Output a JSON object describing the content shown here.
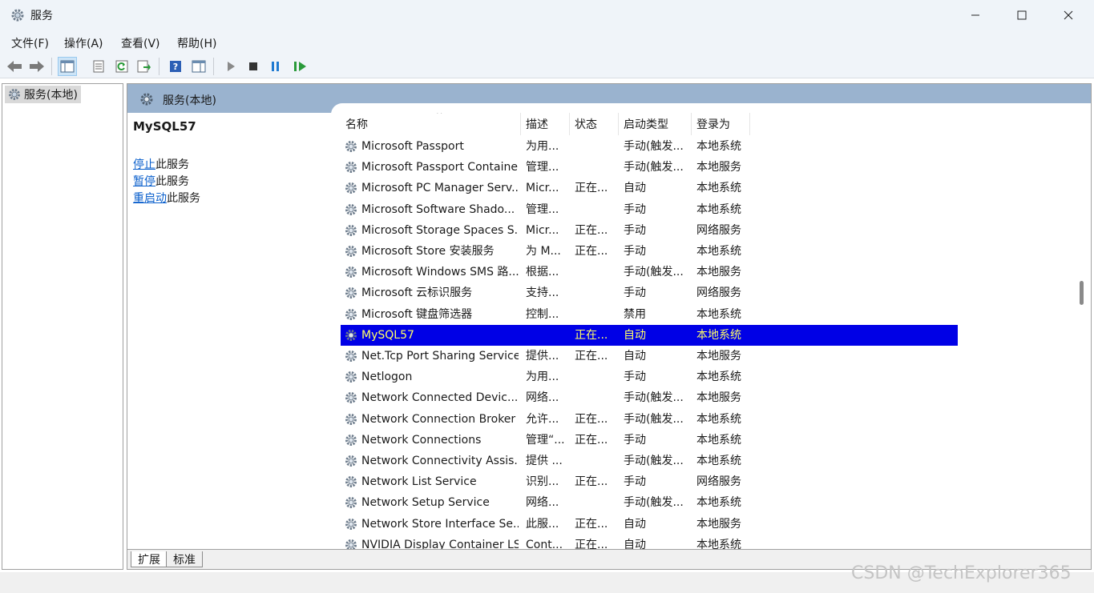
{
  "window": {
    "title": "服务"
  },
  "menu": [
    "文件(F)",
    "操作(A)",
    "查看(V)",
    "帮助(H)"
  ],
  "tree": {
    "root": "服务(本地)"
  },
  "pane": {
    "title": "服务(本地)"
  },
  "selected_service": {
    "name": "MySQL57",
    "actions": [
      {
        "link": "停止",
        "suffix": "此服务"
      },
      {
        "link": "暂停",
        "suffix": "此服务"
      },
      {
        "link": "重启动",
        "suffix": "此服务"
      }
    ]
  },
  "columns": [
    "名称",
    "描述",
    "状态",
    "启动类型",
    "登录为"
  ],
  "rows": [
    {
      "name": "Microsoft Passport",
      "desc": "为用...",
      "status": "",
      "start": "手动(触发...",
      "logon": "本地系统"
    },
    {
      "name": "Microsoft Passport Container",
      "desc": "管理...",
      "status": "",
      "start": "手动(触发...",
      "logon": "本地服务"
    },
    {
      "name": "Microsoft PC Manager Serv...",
      "desc": "Micr...",
      "status": "正在...",
      "start": "自动",
      "logon": "本地系统"
    },
    {
      "name": "Microsoft Software Shado...",
      "desc": "管理...",
      "status": "",
      "start": "手动",
      "logon": "本地系统"
    },
    {
      "name": "Microsoft Storage Spaces S...",
      "desc": "Micr...",
      "status": "正在...",
      "start": "手动",
      "logon": "网络服务"
    },
    {
      "name": "Microsoft Store 安装服务",
      "desc": "为 M...",
      "status": "正在...",
      "start": "手动",
      "logon": "本地系统"
    },
    {
      "name": "Microsoft Windows SMS 路...",
      "desc": "根据...",
      "status": "",
      "start": "手动(触发...",
      "logon": "本地服务"
    },
    {
      "name": "Microsoft 云标识服务",
      "desc": "支持...",
      "status": "",
      "start": "手动",
      "logon": "网络服务"
    },
    {
      "name": "Microsoft 键盘筛选器",
      "desc": "控制...",
      "status": "",
      "start": "禁用",
      "logon": "本地系统"
    },
    {
      "name": "MySQL57",
      "desc": "",
      "status": "正在...",
      "start": "自动",
      "logon": "本地系统",
      "selected": true
    },
    {
      "name": "Net.Tcp Port Sharing Service",
      "desc": "提供...",
      "status": "正在...",
      "start": "自动",
      "logon": "本地服务"
    },
    {
      "name": "Netlogon",
      "desc": "为用...",
      "status": "",
      "start": "手动",
      "logon": "本地系统"
    },
    {
      "name": "Network Connected Devic...",
      "desc": "网络...",
      "status": "",
      "start": "手动(触发...",
      "logon": "本地服务"
    },
    {
      "name": "Network Connection Broker",
      "desc": "允许...",
      "status": "正在...",
      "start": "手动(触发...",
      "logon": "本地系统"
    },
    {
      "name": "Network Connections",
      "desc": "管理“...",
      "status": "正在...",
      "start": "手动",
      "logon": "本地系统"
    },
    {
      "name": "Network Connectivity Assis...",
      "desc": "提供 ...",
      "status": "",
      "start": "手动(触发...",
      "logon": "本地系统"
    },
    {
      "name": "Network List Service",
      "desc": "识别...",
      "status": "正在...",
      "start": "手动",
      "logon": "网络服务"
    },
    {
      "name": "Network Setup Service",
      "desc": "网络...",
      "status": "",
      "start": "手动(触发...",
      "logon": "本地系统"
    },
    {
      "name": "Network Store Interface Se...",
      "desc": "此服...",
      "status": "正在...",
      "start": "自动",
      "logon": "本地服务"
    },
    {
      "name": "NVIDIA Display Container LS",
      "desc": "Cont...",
      "status": "正在...",
      "start": "自动",
      "logon": "本地系统"
    }
  ],
  "tabs": [
    "扩展",
    "标准"
  ],
  "watermark": "CSDN @TechExplorer365",
  "icons": {
    "app": "services-gear-icon",
    "service": "gear-icon"
  }
}
